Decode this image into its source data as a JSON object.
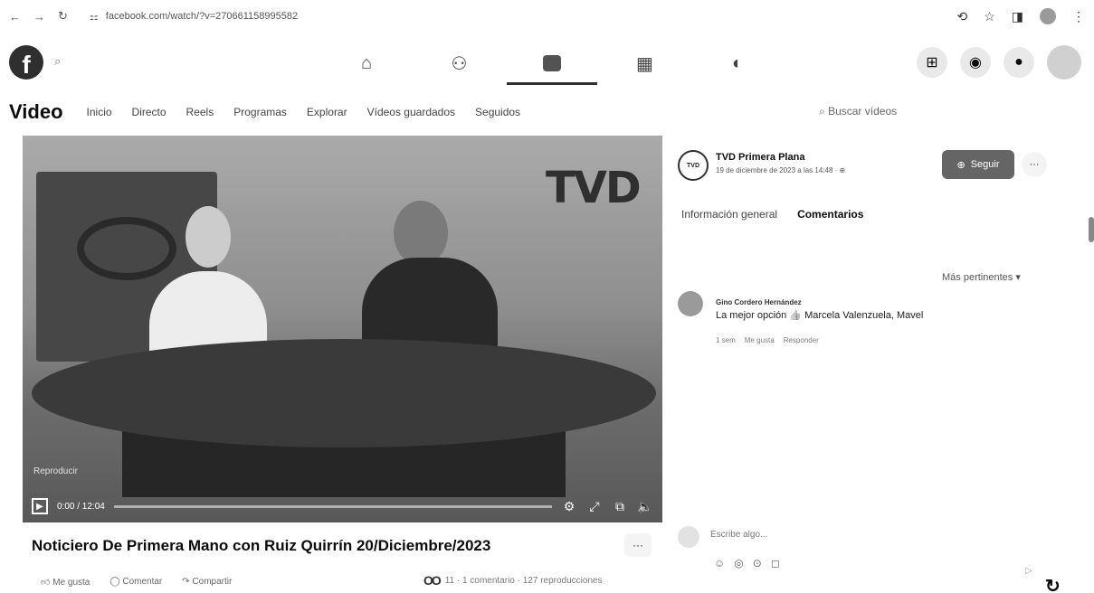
{
  "browser": {
    "back": "←",
    "forward": "→",
    "reload": "↻",
    "site_icon": "⚏",
    "url": "facebook.com/watch/?v=270661158995582",
    "actions": [
      "⟲",
      "☆",
      "◨",
      "⋮"
    ]
  },
  "fb": {
    "logo": "f",
    "search_icon": "⌕",
    "nav": [
      {
        "icon": "home-icon",
        "glyph": "⌂"
      },
      {
        "icon": "friends-icon",
        "glyph": "⚇"
      },
      {
        "icon": "watch-icon",
        "glyph": ""
      },
      {
        "icon": "marketplace-icon",
        "glyph": "▦"
      },
      {
        "icon": "gaming-icon",
        "glyph": "◐"
      }
    ],
    "right": [
      "⊞",
      "◉",
      "●"
    ]
  },
  "video_nav": {
    "title": "Video",
    "tabs": [
      "Inicio",
      "Directo",
      "Reels",
      "Programas",
      "Explorar",
      "Vídeos guardados",
      "Seguidos"
    ],
    "search": "Buscar vídeos"
  },
  "player": {
    "logo": "TVD",
    "overlay": "Reproducir",
    "time": "0:00 / 12:04",
    "progress": 0.0,
    "icons": [
      "⚙",
      "⤢",
      "⧉",
      "🔈"
    ]
  },
  "video": {
    "title": "Noticiero De Primera Mano con Ruiz Quirrín 20/Diciembre/2023",
    "more": "···",
    "actions": [
      "Me gusta",
      "Comentar",
      "Compartir"
    ],
    "reaction_icons": "OO",
    "stats": "11 · 1 comentario · 127 reproducciones"
  },
  "panel": {
    "avatar_text": "TVD",
    "page_name": "TVD Primera Plana",
    "date": "19 de diciembre de 2023 a las 14:48 · ⊕",
    "follow": "Seguir",
    "follow_icon": "⊕",
    "more": "···",
    "tabs": [
      "Información general",
      "Comentarios"
    ],
    "sort": "Más pertinentes ▾",
    "comment": {
      "author": "Gino Cordero Hernández",
      "text": "La mejor opción 👍 Marcela Valenzuela, Mavel",
      "actions": [
        "1 sem",
        "Me gusta",
        "Responder"
      ]
    },
    "write_placeholder": "Escribe algo...",
    "write_icons": [
      "☺",
      "◎",
      "⊙",
      "◻"
    ],
    "send": "▷",
    "float": "↻"
  }
}
